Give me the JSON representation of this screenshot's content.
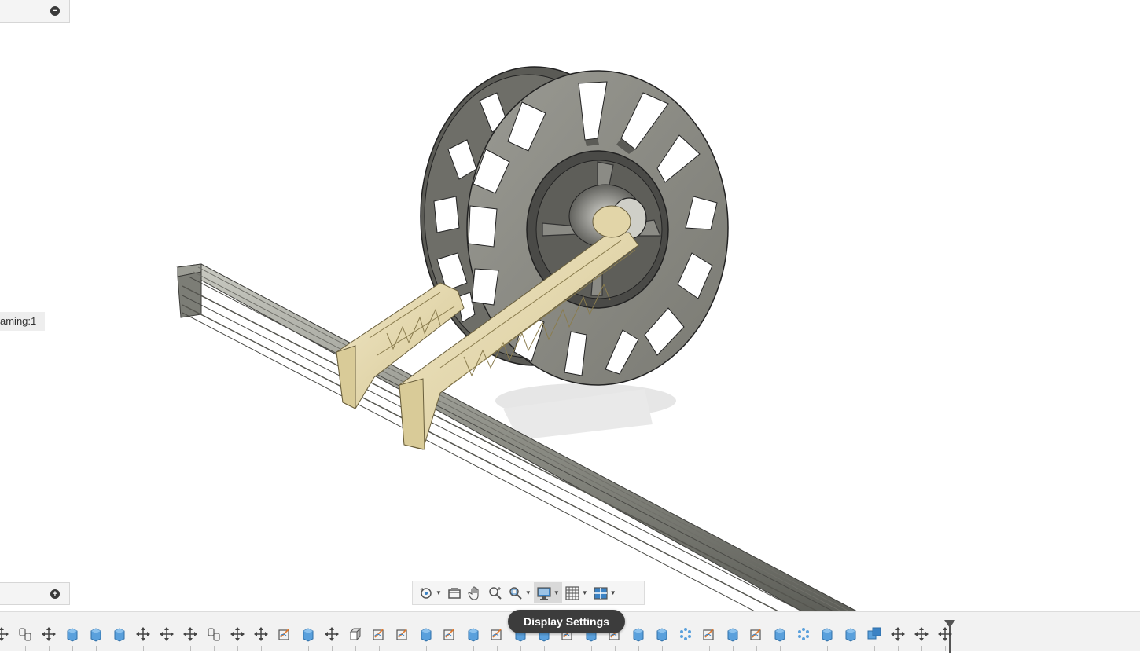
{
  "browser": {
    "component_label": "aming:1",
    "collapse_symbol": "−",
    "expand_symbol": "+"
  },
  "model": {
    "spool": "spool-model",
    "holder": "spool-holder-bracket",
    "rail": "aluminum-extrusion-rail",
    "colors": {
      "spool": "#8a8a84",
      "spool_dark": "#3d3d3b",
      "holder": "#e8dcb3",
      "rail": "#a9aaa2"
    }
  },
  "navbar": {
    "items": [
      {
        "name": "orbit-icon",
        "has_caret": true
      },
      {
        "name": "look-at-icon",
        "has_caret": false
      },
      {
        "name": "pan-icon",
        "has_caret": false
      },
      {
        "name": "zoom-icon",
        "has_caret": false
      },
      {
        "name": "fit-icon",
        "has_caret": true
      },
      {
        "name": "display-settings-icon",
        "has_caret": true
      },
      {
        "name": "grid-snaps-icon",
        "has_caret": true
      },
      {
        "name": "viewports-icon",
        "has_caret": true
      }
    ],
    "tooltip": "Display Settings"
  },
  "timeline": {
    "items": [
      "move",
      "joint",
      "move",
      "extrude",
      "extrude",
      "extrude",
      "move",
      "move",
      "move",
      "joint",
      "move",
      "move",
      "sketch",
      "extrude",
      "move",
      "box",
      "sketch",
      "sketch",
      "extrude",
      "sketch",
      "extrude",
      "sketch",
      "extrude",
      "extrude",
      "sketch",
      "extrude",
      "sketch",
      "extrude",
      "extrude",
      "pattern",
      "sketch",
      "extrude",
      "sketch",
      "extrude",
      "pattern",
      "extrude",
      "extrude",
      "combine",
      "move",
      "move",
      "move"
    ]
  }
}
